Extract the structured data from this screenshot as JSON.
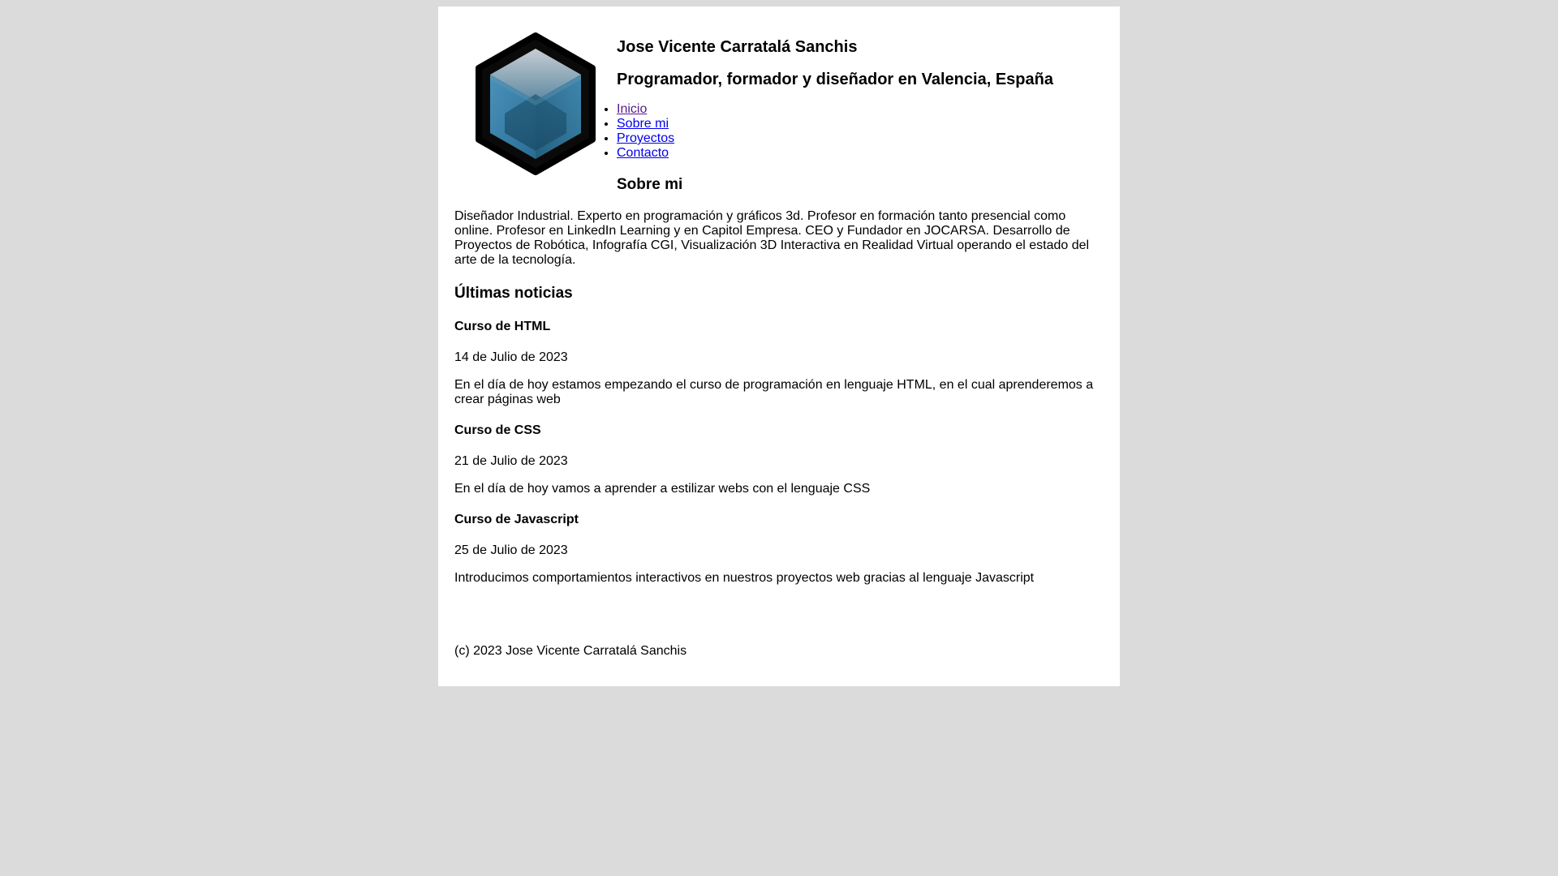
{
  "header": {
    "title": "Jose Vicente Carratalá Sanchis",
    "subtitle": "Programador, formador y diseñador en Valencia, España",
    "logo_icon": "hexagon-cube-logo",
    "colors": {
      "logo_outer": "#000000",
      "logo_top": "#9aa8b3",
      "logo_side_light": "#3b7fa6",
      "logo_side_dark": "#215a7a"
    }
  },
  "nav": {
    "items": [
      {
        "label": "Inicio",
        "visited": true
      },
      {
        "label": "Sobre mi",
        "visited": false
      },
      {
        "label": "Proyectos",
        "visited": false
      },
      {
        "label": "Contacto",
        "visited": false
      }
    ],
    "link_color": "#0000ee",
    "visited_color": "#551a8b"
  },
  "about": {
    "heading": "Sobre mi",
    "text": "Diseñador Industrial. Experto en programación y gráficos 3d. Profesor en formación tanto presencial como online. Profesor en LinkedIn Learning y en Capitol Empresa. CEO y Fundador en JOCARSA. Desarrollo de Proyectos de Robótica, Infografía CGI, Visualización 3D Interactiva en Realidad Virtual operando el estado del arte de la tecnología."
  },
  "news": {
    "heading": "Últimas noticias",
    "articles": [
      {
        "title": "Curso de HTML",
        "date": "14 de Julio de 2023",
        "text": "En el día de hoy estamos empezando el curso de programación en lenguaje HTML, en el cual aprenderemos a crear páginas web"
      },
      {
        "title": "Curso de CSS",
        "date": "21 de Julio de 2023",
        "text": "En el día de hoy vamos a aprender a estilizar webs con el lenguaje CSS"
      },
      {
        "title": "Curso de Javascript",
        "date": "25 de Julio de 2023",
        "text": "Introducimos comportamientos interactivos en nuestros proyectos web gracias al lenguaje Javascript"
      }
    ]
  },
  "footer": {
    "text": "(c) 2023 Jose Vicente Carratalá Sanchis"
  },
  "page": {
    "background": "#dbdbdb",
    "content_background": "#ffffff"
  }
}
